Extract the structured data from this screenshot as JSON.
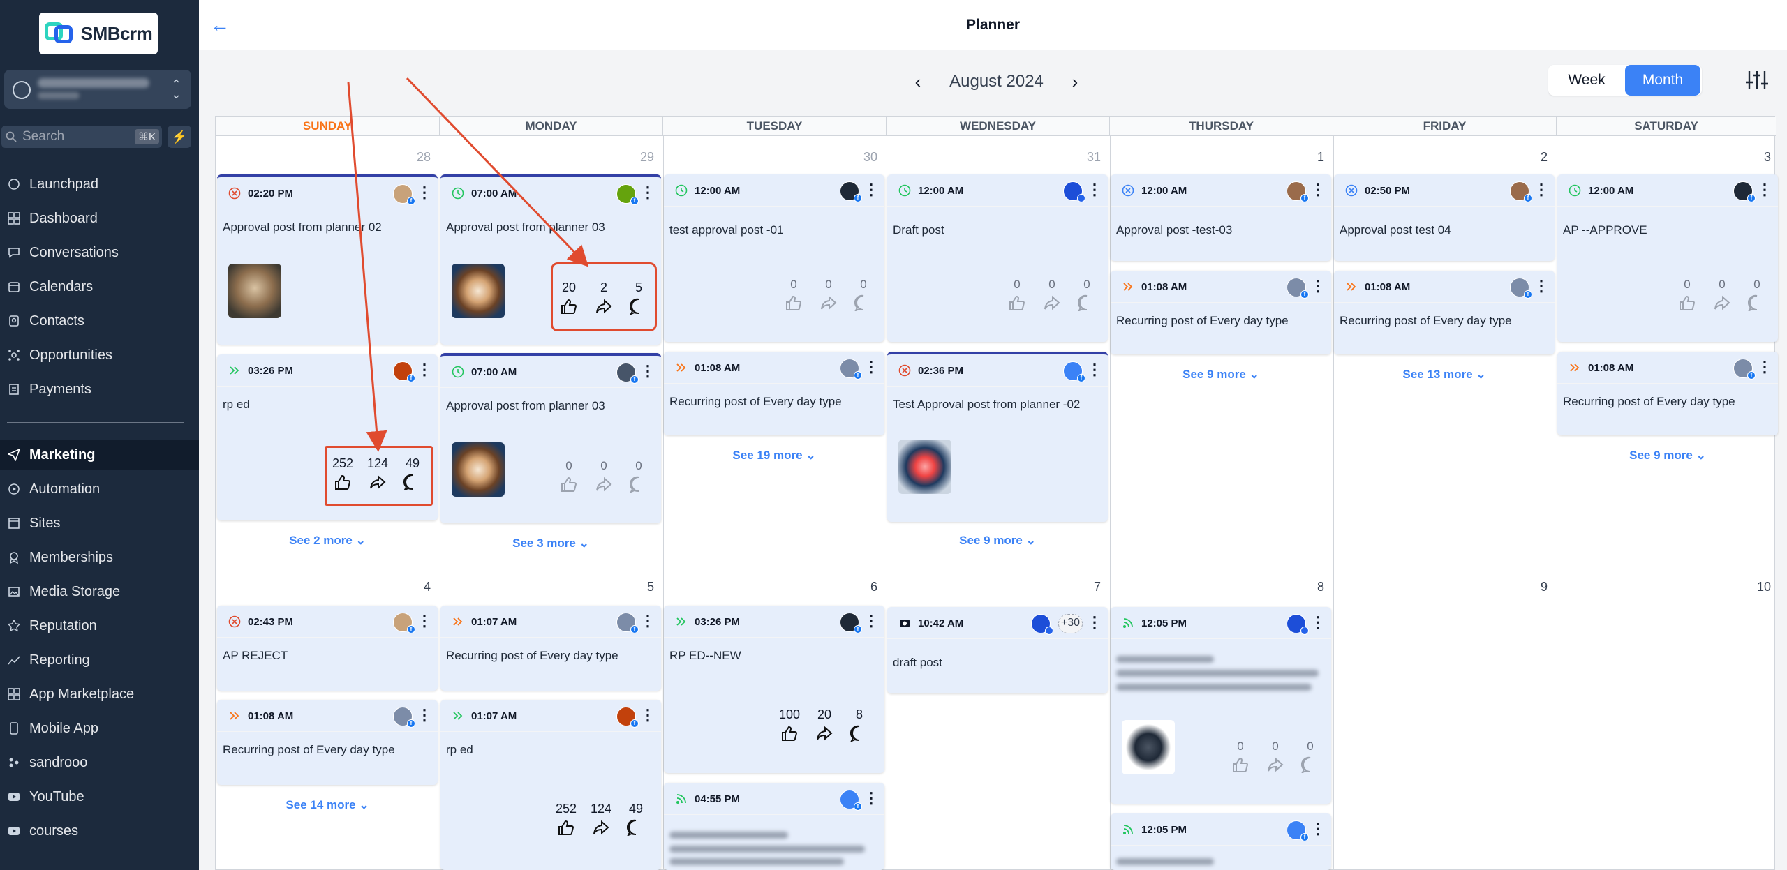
{
  "sidebar": {
    "logo_text": "SMBcrm",
    "search_placeholder": "Search",
    "search_shortcut": "⌘K",
    "items": [
      {
        "label": "Launchpad",
        "icon": "launchpad-icon"
      },
      {
        "label": "Dashboard",
        "icon": "dashboard-icon"
      },
      {
        "label": "Conversations",
        "icon": "chat-icon"
      },
      {
        "label": "Calendars",
        "icon": "calendar-icon"
      },
      {
        "label": "Contacts",
        "icon": "contacts-icon"
      },
      {
        "label": "Opportunities",
        "icon": "opportunities-icon"
      },
      {
        "label": "Payments",
        "icon": "payments-icon"
      },
      {
        "label": "Marketing",
        "icon": "send-icon",
        "active": true
      },
      {
        "label": "Automation",
        "icon": "automation-icon"
      },
      {
        "label": "Sites",
        "icon": "sites-icon"
      },
      {
        "label": "Memberships",
        "icon": "membership-icon"
      },
      {
        "label": "Media Storage",
        "icon": "media-icon"
      },
      {
        "label": "Reputation",
        "icon": "star-icon"
      },
      {
        "label": "Reporting",
        "icon": "reporting-icon"
      },
      {
        "label": "App Marketplace",
        "icon": "marketplace-icon"
      },
      {
        "label": "Mobile App",
        "icon": "mobile-icon"
      },
      {
        "label": "sandrooo",
        "icon": "sandrooo-icon"
      },
      {
        "label": "YouTube",
        "icon": "youtube-icon"
      },
      {
        "label": "courses",
        "icon": "courses-icon"
      }
    ]
  },
  "header": {
    "title": "Planner",
    "month_label": "August 2024",
    "view_week": "Week",
    "view_month": "Month",
    "active_view": "Month"
  },
  "calendar": {
    "weekdays": [
      "SUNDAY",
      "MONDAY",
      "TUESDAY",
      "WEDNESDAY",
      "THURSDAY",
      "FRIDAY",
      "SATURDAY"
    ],
    "week1_dates": [
      "28",
      "29",
      "30",
      "31",
      "1",
      "2",
      "3"
    ],
    "week2_dates": [
      "4",
      "5",
      "6",
      "7",
      "8",
      "9",
      "10"
    ],
    "posts": {
      "c0": {
        "time": "02:20 PM",
        "title": "Approval post from planner 02"
      },
      "c1": {
        "time": "03:26 PM",
        "title": "rp ed",
        "likes": "252",
        "shares": "124",
        "comments": "49"
      },
      "c2": {
        "time": "07:00 AM",
        "title": "Approval post from planner 03",
        "likes": "20",
        "shares": "2",
        "comments": "5"
      },
      "c3": {
        "time": "07:00 AM",
        "title": "Approval post from planner 03",
        "likes": "0",
        "shares": "0",
        "comments": "0"
      },
      "c4": {
        "time": "12:00 AM",
        "title": "test approval post -01",
        "likes": "0",
        "shares": "0",
        "comments": "0"
      },
      "c5": {
        "time": "01:08 AM",
        "title": "Recurring post of Every day type"
      },
      "c6": {
        "time": "12:00 AM",
        "title": "Draft post",
        "likes": "0",
        "shares": "0",
        "comments": "0"
      },
      "c7": {
        "time": "02:36 PM",
        "title": "Test Approval post from planner -02"
      },
      "c8": {
        "time": "12:00 AM",
        "title": "Approval post -test-03"
      },
      "c9": {
        "time": "01:08 AM",
        "title": "Recurring post of Every day type"
      },
      "c10": {
        "time": "02:50 PM",
        "title": "Approval post test 04"
      },
      "c11": {
        "time": "01:08 AM",
        "title": "Recurring post of Every day type"
      },
      "c12": {
        "time": "12:00 AM",
        "title": "AP --APPROVE",
        "likes": "0",
        "shares": "0",
        "comments": "0"
      },
      "c13": {
        "time": "01:08 AM",
        "title": "Recurring post of Every day type"
      },
      "c14": {
        "time": "02:43 PM",
        "title": "AP REJECT"
      },
      "c15": {
        "time": "01:08 AM",
        "title": "Recurring post of Every day type"
      },
      "c16": {
        "time": "01:07 AM",
        "title": "Recurring post of Every day type"
      },
      "c17": {
        "time": "01:07 AM",
        "title": "rp ed",
        "likes": "252",
        "shares": "124",
        "comments": "49"
      },
      "c18": {
        "time": "03:26 PM",
        "title": "RP ED--NEW",
        "likes": "100",
        "shares": "20",
        "comments": "8"
      },
      "c19": {
        "time": "04:55 PM"
      },
      "c20": {
        "time": "10:42 AM",
        "title": "draft post",
        "extra_count": "+30"
      },
      "c21": {
        "time": "12:05 PM",
        "likes": "0",
        "shares": "0",
        "comments": "0"
      },
      "c22": {
        "time": "12:05 PM"
      }
    },
    "see_more": {
      "sun1": "See 2 more",
      "mon1": "See 3 more",
      "tue1": "See 19 more",
      "wed1": "See 9 more",
      "thu1": "See 9 more",
      "fri1": "See 13 more",
      "sat1": "See 9 more",
      "sun2": "See 14 more"
    }
  },
  "colors": {
    "accent": "#3b82f6",
    "sidebar_bg": "#1c2a3d",
    "card_bg": "#e6eefb",
    "annotation": "#e04b2f",
    "weekend_header": "#f97316"
  }
}
